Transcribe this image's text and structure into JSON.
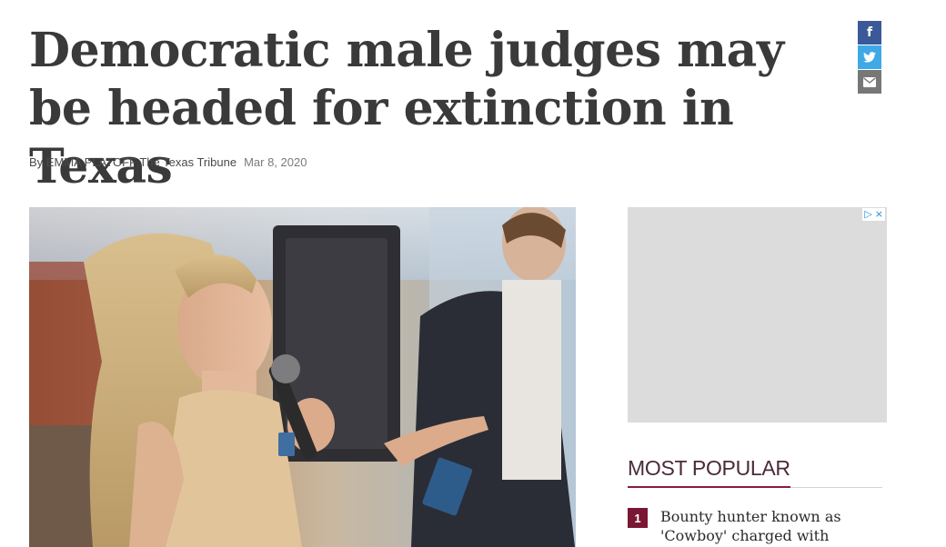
{
  "article": {
    "headline": "Democratic male judges may be headed for extinction in Texas",
    "byline": "By EMMA PLATOFF The Texas Tribune",
    "date": "Mar 8, 2020"
  },
  "share": {
    "facebook_glyph": "f",
    "twitter_glyph": "t",
    "email_glyph": "✉",
    "colors": {
      "facebook": "#3b5998",
      "twitter": "#3fa9e6",
      "email": "#777777"
    }
  },
  "ad": {
    "choices_icon": "ad-choices-icon",
    "close_glyph": "×",
    "play_glyph": "▷"
  },
  "most_popular": {
    "title": "MOST POPULAR",
    "items": [
      {
        "rank": "1",
        "text": "Bounty hunter known as 'Cowboy' charged with sexual"
      }
    ]
  },
  "colors": {
    "accent": "#7a1735",
    "headline": "#3a3a3a"
  }
}
